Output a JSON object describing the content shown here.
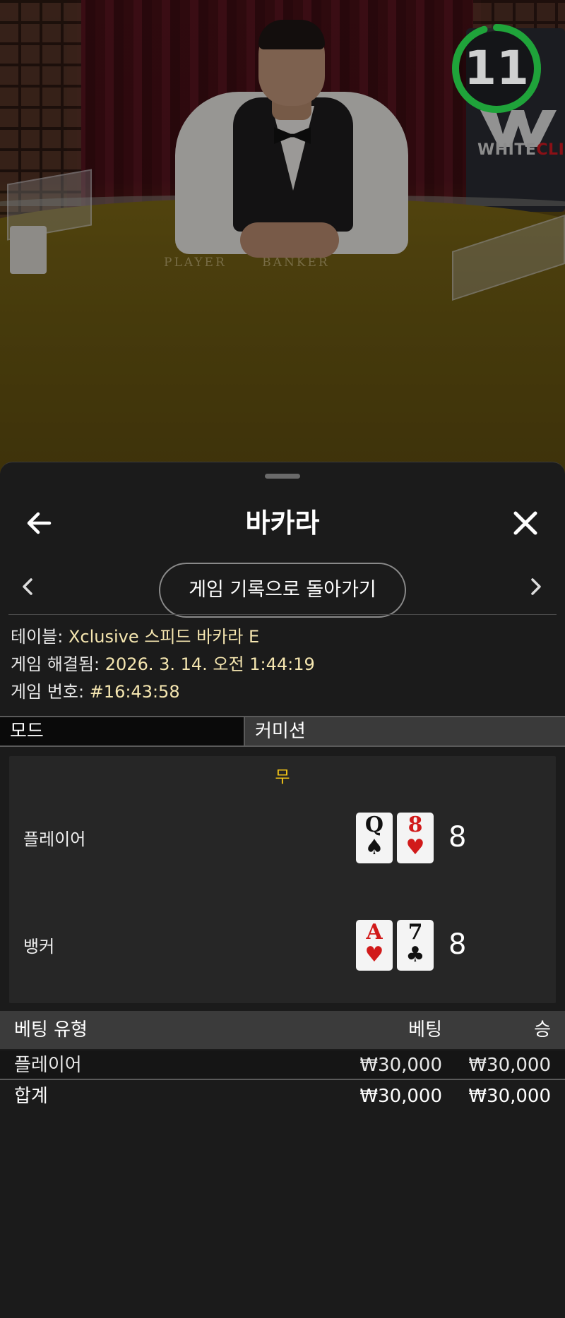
{
  "video": {
    "felt_text": "PLAYER      BANKER",
    "brand": {
      "part1": "WHITE",
      "part2": "CLIFF"
    },
    "timer": {
      "value": "11",
      "progress": 0.95,
      "color": "#1fa33a"
    }
  },
  "header": {
    "title": "바카라"
  },
  "nav": {
    "return_label": "게임 기록으로 돌아가기"
  },
  "info": {
    "table_label": "테이블:",
    "table_value": "Xclusive 스피드 바카라 E",
    "settled_label": "게임 해결됨:",
    "settled_value": "2026. 3. 14. 오전 1:44:19",
    "game_no_label": "게임 번호:",
    "game_no_value": "#16:43:58"
  },
  "mode": {
    "label": "모드",
    "value": "커미션"
  },
  "result": {
    "outcome": "무",
    "outcome_color": "#f2c417",
    "player": {
      "name": "플레이어",
      "cards": [
        {
          "rank": "Q",
          "suit": "♠",
          "color": "black"
        },
        {
          "rank": "8",
          "suit": "♥",
          "color": "red"
        }
      ],
      "score": "8"
    },
    "banker": {
      "name": "뱅커",
      "cards": [
        {
          "rank": "A",
          "suit": "♥",
          "color": "red"
        },
        {
          "rank": "7",
          "suit": "♣",
          "color": "black"
        }
      ],
      "score": "8"
    }
  },
  "bets": {
    "headers": {
      "type": "베팅 유형",
      "bet": "베팅",
      "win": "승"
    },
    "rows": [
      {
        "type": "플레이어",
        "bet": "₩30,000",
        "win": "₩30,000"
      }
    ],
    "total": {
      "type": "합계",
      "bet": "₩30,000",
      "win": "₩30,000"
    }
  }
}
